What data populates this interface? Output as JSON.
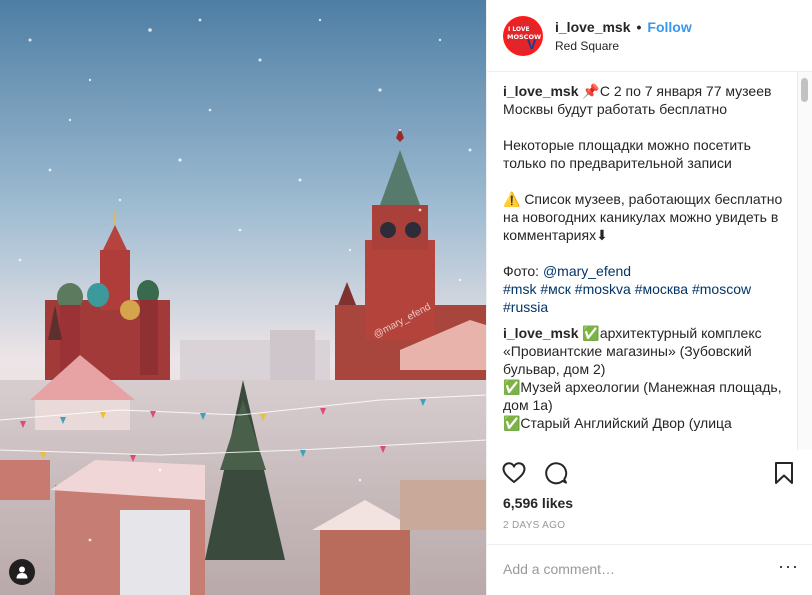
{
  "post": {
    "username": "i_love_msk",
    "follow_label": "Follow",
    "separator": "•",
    "location": "Red Square",
    "avatar_text": {
      "line1": "I LOVE",
      "line2": "MOSCOW",
      "mark": "V"
    },
    "photo_watermark": "@mary_efend"
  },
  "caption": {
    "username": "i_love_msk",
    "line1": "📌С 2 по 7 января 77 музеев Москвы будут работать бесплатно",
    "line2": "Некоторые площадки можно посетить только по предварительной записи",
    "line3": "⚠️ Список музеев, работающих бесплатно на новогодних каникулах можно увидеть в комментариях⬇",
    "photo_prefix": "Фото:",
    "photo_link": "@mary_efend",
    "tags": [
      "#msk",
      "#мск",
      "#moskva",
      "#москва",
      "#moscow",
      "#russia"
    ]
  },
  "comment1": {
    "username": "i_love_msk",
    "text": "✅архитектурный комплекс «Провиантские магазины» (Зубовский бульвар, дом 2)",
    "line2": "✅Музей археологии (Манежная площадь, дом 1а)",
    "line3": "✅Старый Английский Двор (улица"
  },
  "actions": {
    "like_icon": "heart-icon",
    "comment_icon": "comment-bubble-icon",
    "save_icon": "bookmark-icon"
  },
  "likes": "6,596 likes",
  "timestamp": "2 DAYS AGO",
  "add_comment": {
    "placeholder": "Add a comment…",
    "more": "···"
  },
  "colors": {
    "accent": "#3897f0",
    "link": "#003569",
    "text": "#262626",
    "muted": "#999999",
    "avatar": "#e0262a"
  }
}
